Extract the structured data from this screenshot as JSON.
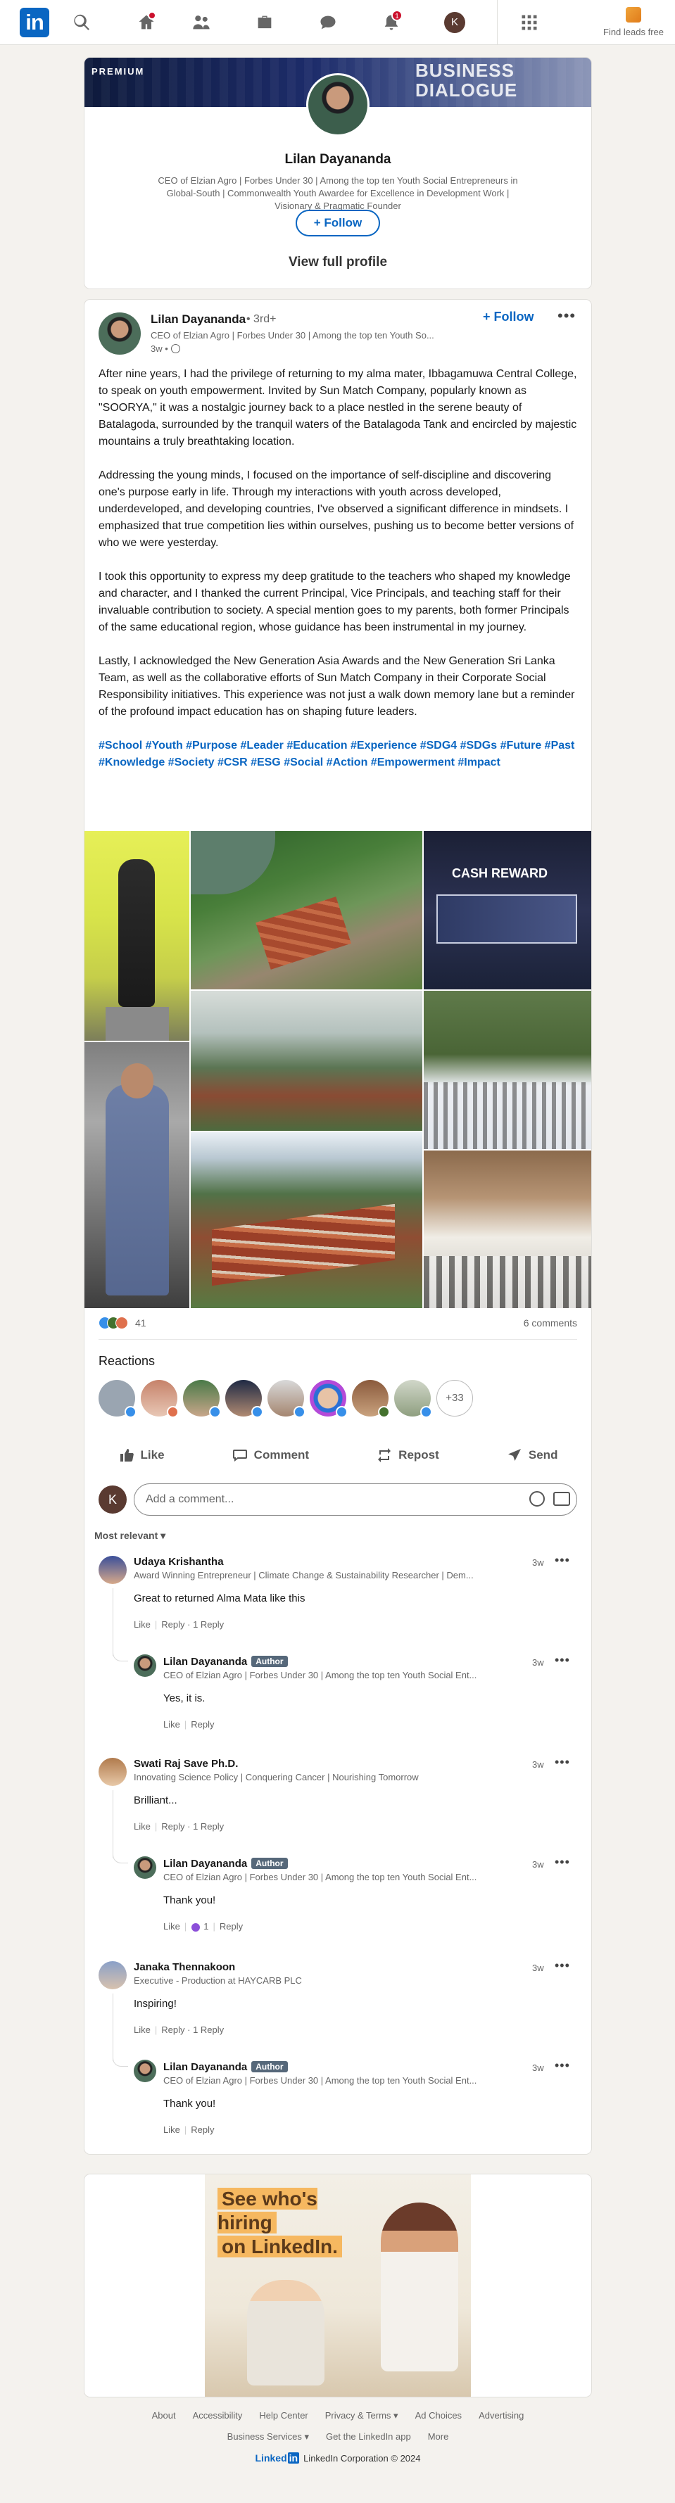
{
  "nav": {
    "logo": "in",
    "notifications_count": "1",
    "me_initial": "K",
    "find_leads": "Find leads free"
  },
  "profile": {
    "banner_label": "PREMIUM",
    "banner_text_line1": "BUSINESS",
    "banner_text_line2": "DIALOGUE",
    "name": "Lilan Dayananda",
    "headline": "CEO of Elzian Agro | Forbes Under 30 | Among the top ten Youth Social Entrepreneurs in Global-South | Commonwealth Youth Awardee for Excellence in Development Work | Visionary & Pragmatic Founder",
    "follow_label": "+ Follow",
    "view_profile": "View full profile"
  },
  "post": {
    "author": "Lilan Dayananda",
    "degree": "• 3rd+",
    "headline": "CEO of Elzian Agro | Forbes Under 30 | Among the top ten Youth So...",
    "time": "3w •",
    "follow_label": "+ Follow",
    "more": "•••",
    "paragraphs": [
      "After nine years, I had the privilege of returning to my alma mater, Ibbagamuwa Central College, to speak on youth empowerment. Invited by Sun Match Company, popularly known as \"SOORYA,\" it was a nostalgic journey back to a place nestled in the serene beauty of Batalagoda, surrounded by the tranquil waters of the Batalagoda Tank and encircled by majestic mountains a truly breathtaking location.",
      "Addressing the young minds, I focused on the importance of self-discipline and discovering one's purpose early in life. Through my interactions with youth across developed, underdeveloped, and developing countries, I've observed a significant difference in mindsets. I emphasized that true competition lies within ourselves, pushing us to become better versions of who we were yesterday.",
      "I took this opportunity to express my deep gratitude to the teachers who shaped my knowledge and character, and I thanked the current Principal, Vice Principals, and teaching staff for their invaluable contribution to society. A special mention goes to my parents, both former Principals of the same educational region, whose guidance has been instrumental in my journey.",
      "Lastly, I acknowledged the New Generation Asia Awards and the New Generation Sri Lanka Team, as well as the collaborative efforts of Sun Match Company in their Corporate Social Responsibility initiatives. This experience was not just a walk down memory lane but a reminder of the profound impact education has on shaping future leaders."
    ],
    "hashtags": "#School #Youth #Purpose #Leader #Education #Experience #SDG4 #SDGs #Future #Past #Knowledge #Society #CSR #ESG #Social #Action #Empowerment #Impact",
    "photo_award_label": "CASH REWARD",
    "reactions_count": "41",
    "comments_count": "6 comments",
    "reactions_title": "Reactions",
    "reactions_more": "+33",
    "actions": {
      "like": "Like",
      "comment": "Comment",
      "repost": "Repost",
      "send": "Send"
    },
    "add_comment_placeholder": "Add a comment...",
    "viewer_initial": "K",
    "sort_label": "Most relevant ▾"
  },
  "comments": [
    {
      "name": "Udaya Krishantha",
      "headline": "Award Winning Entrepreneur | Climate Change & Sustainability Researcher | Dem...",
      "time": "3w",
      "text": "Great to returned Alma Mata like this",
      "actions": "Like",
      "reply": "Reply",
      "reply_count": "· 1 Reply",
      "reply_item": {
        "name": "Lilan Dayananda",
        "badge": "Author",
        "headline": "CEO of Elzian Agro | Forbes Under 30 | Among the top ten Youth Social Ent...",
        "time": "3w",
        "text": "Yes, it is.",
        "like": "Like",
        "reply": "Reply"
      }
    },
    {
      "name": "Swati Raj Save Ph.D.",
      "headline": "Innovating Science Policy | Conquering Cancer | Nourishing Tomorrow",
      "time": "3w",
      "text": "Brilliant...",
      "actions": "Like",
      "reply": "Reply",
      "reply_count": "· 1 Reply",
      "reply_item": {
        "name": "Lilan Dayananda",
        "badge": "Author",
        "headline": "CEO of Elzian Agro | Forbes Under 30 | Among the top ten Youth Social Ent...",
        "time": "3w",
        "text": "Thank you!",
        "like": "Like",
        "like_count": "1",
        "reply": "Reply"
      }
    },
    {
      "name": "Janaka Thennakoon",
      "headline": "Executive - Production at HAYCARB PLC",
      "time": "3w",
      "text": "Inspiring!",
      "actions": "Like",
      "reply": "Reply",
      "reply_count": "· 1 Reply",
      "reply_item": {
        "name": "Lilan Dayananda",
        "badge": "Author",
        "headline": "CEO of Elzian Agro | Forbes Under 30 | Among the top ten Youth Social Ent...",
        "time": "3w",
        "text": "Thank you!",
        "like": "Like",
        "reply": "Reply"
      }
    }
  ],
  "ad": {
    "line1": "See who's hiring",
    "line2": "on LinkedIn."
  },
  "footer": {
    "row1": [
      "About",
      "Accessibility",
      "Help Center",
      "Privacy & Terms ▾",
      "Ad Choices",
      "Advertising"
    ],
    "row2": [
      "Business Services ▾",
      "Get the LinkedIn app",
      "More"
    ],
    "brand_word": "Linked",
    "brand_in": "in",
    "copyright": "LinkedIn Corporation © 2024"
  }
}
